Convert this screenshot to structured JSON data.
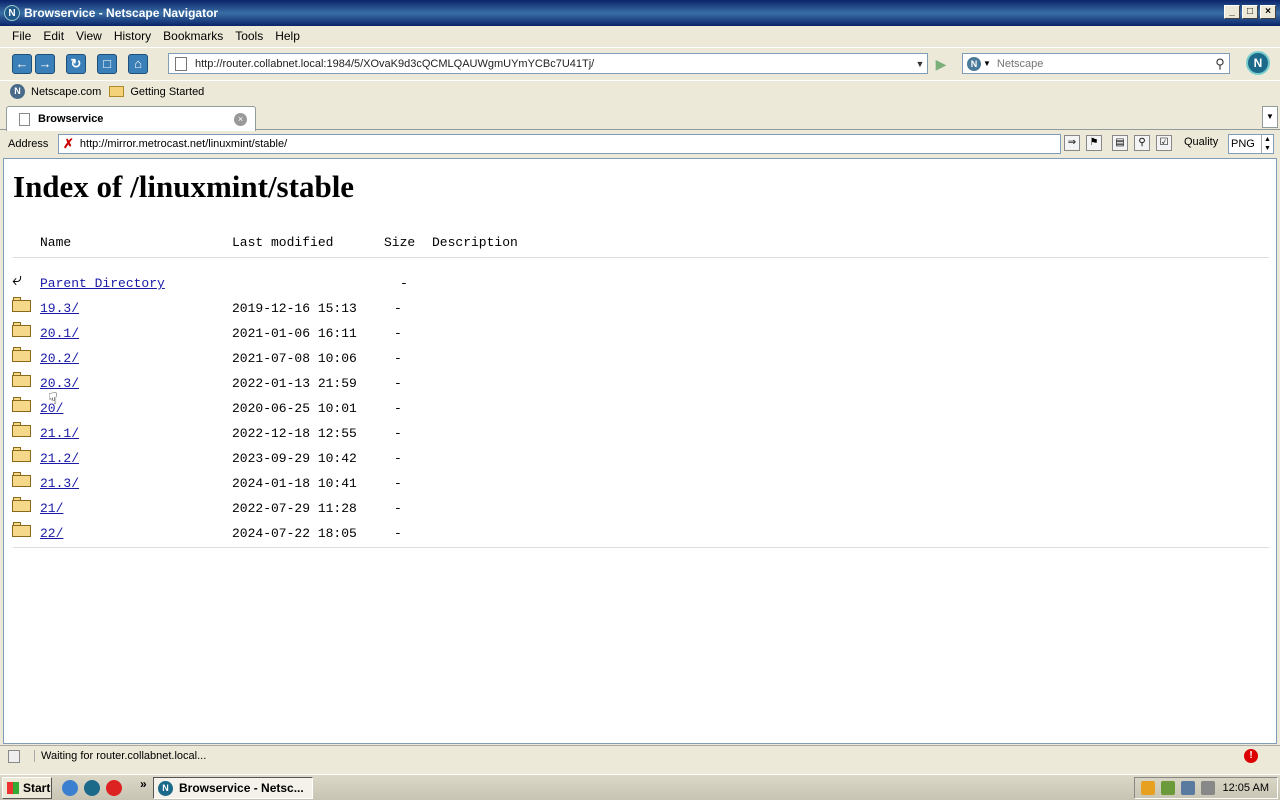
{
  "window": {
    "title": "Browservice - Netscape Navigator",
    "app_icon": "N",
    "min": "_",
    "max": "□",
    "close": "×"
  },
  "menu": {
    "items": [
      {
        "label": "File"
      },
      {
        "label": "Edit"
      },
      {
        "label": "View"
      },
      {
        "label": "History"
      },
      {
        "label": "Bookmarks"
      },
      {
        "label": "Tools"
      },
      {
        "label": "Help"
      }
    ]
  },
  "toolbar": {
    "url": "http://router.collabnet.local:1984/5/XOvaK9d3cQCMLQAUWgmUYmYCBc7U41Tj/",
    "search_placeholder": "Netscape",
    "search_engine": "N",
    "throbber": "N",
    "icons": [
      "back-arrow-icon",
      "forward-arrow-icon",
      "reload-icon",
      "stop-icon",
      "home-icon"
    ]
  },
  "bookmarks": {
    "items": [
      {
        "label": "Netscape.com",
        "icon": "netscape-icon"
      },
      {
        "label": "Getting Started",
        "icon": "folder-icon"
      }
    ]
  },
  "tabs": [
    {
      "label": "Browservice",
      "active": true
    }
  ],
  "address_bar": {
    "label": "Address",
    "value": "http://mirror.metrocast.net/linuxmint/stable/",
    "quality_label": "Quality",
    "quality_value": "PNG"
  },
  "page": {
    "title": "Index of /linuxmint/stable",
    "headers": {
      "name": "Name",
      "modified": "Last modified",
      "size": "Size",
      "description": "Description"
    },
    "parent": {
      "name": "Parent Directory",
      "size": "-"
    },
    "rows": [
      {
        "name": "19.3/",
        "modified": "2019-12-16 15:13",
        "size": "-"
      },
      {
        "name": "20.1/",
        "modified": "2021-01-06 16:11",
        "size": "-"
      },
      {
        "name": "20.2/",
        "modified": "2021-07-08 10:06",
        "size": "-"
      },
      {
        "name": "20.3/",
        "modified": "2022-01-13 21:59",
        "size": "-"
      },
      {
        "name": "20/",
        "modified": "2020-06-25 10:01",
        "size": "-"
      },
      {
        "name": "21.1/",
        "modified": "2022-12-18 12:55",
        "size": "-"
      },
      {
        "name": "21.2/",
        "modified": "2023-09-29 10:42",
        "size": "-"
      },
      {
        "name": "21.3/",
        "modified": "2024-01-18 10:41",
        "size": "-"
      },
      {
        "name": "21/",
        "modified": "2022-07-29 11:28",
        "size": "-"
      },
      {
        "name": "22/",
        "modified": "2024-07-22 18:05",
        "size": "-"
      }
    ]
  },
  "status": {
    "text": "Waiting for router.collabnet.local..."
  },
  "taskbar": {
    "start_label": "Start",
    "task_label": "Browservice - Netsc...",
    "clock": "12:05 AM"
  }
}
